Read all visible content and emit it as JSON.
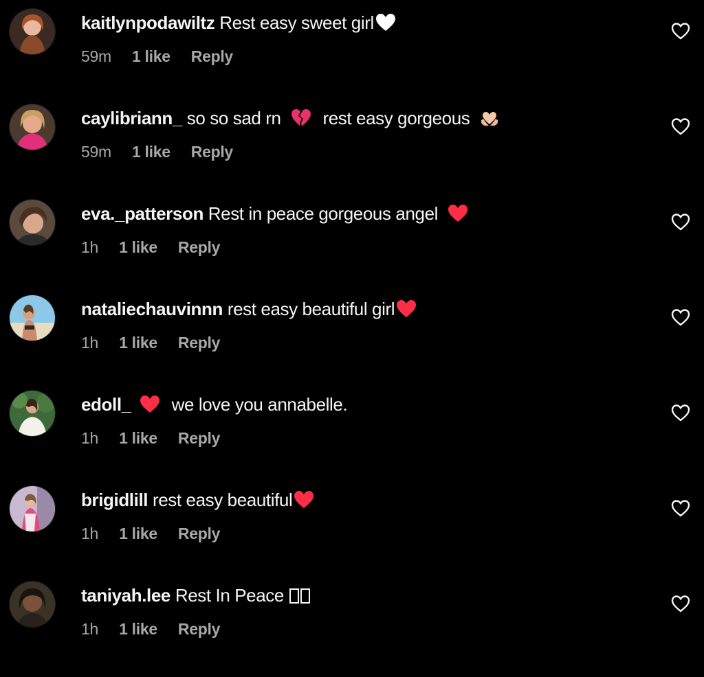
{
  "colors": {
    "background": "#000000",
    "primary_text": "#f5f5f5",
    "secondary_text": "#a8a8a8",
    "heart_red": "#ff2d45",
    "heart_white": "#ffffff"
  },
  "comments": [
    {
      "username": "kaitlynpodawiltz",
      "text": "Rest easy sweet girl",
      "emoji": "white-heart",
      "time": "59m",
      "likes": "1 like",
      "reply": "Reply",
      "avatar": "portrait-auburn-hair"
    },
    {
      "username": "caylibriann_",
      "text": "so so sad rn",
      "text_after": "rest easy gorgeous",
      "emoji": "broken-heart",
      "emoji_after": "heart-hands",
      "time": "59m",
      "likes": "1 like",
      "reply": "Reply",
      "avatar": "portrait-blonde-hair"
    },
    {
      "username": "eva._patterson",
      "text": "Rest in peace gorgeous angel",
      "emoji": "red-heart",
      "time": "1h",
      "likes": "1 like",
      "reply": "Reply",
      "avatar": "portrait-brown-hair"
    },
    {
      "username": "nataliechauvinnn",
      "text": "rest easy beautiful girl",
      "emoji": "red-heart",
      "time": "1h",
      "likes": "1 like",
      "reply": "Reply",
      "avatar": "beach-photo"
    },
    {
      "username": "edoll_",
      "text": "we love you annabelle.",
      "emoji_before": "red-heart",
      "time": "1h",
      "likes": "1 like",
      "reply": "Reply",
      "avatar": "portrait-greenery"
    },
    {
      "username": "brigidlill",
      "text": "rest easy beautiful",
      "emoji": "red-heart",
      "time": "1h",
      "likes": "1 like",
      "reply": "Reply",
      "avatar": "portrait-pink-outfit"
    },
    {
      "username": "taniyah.lee",
      "text": "Rest In Peace",
      "emoji": "missing-glyph",
      "time": "1h",
      "likes": "1 like",
      "reply": "Reply",
      "avatar": "portrait-dark-hair"
    }
  ]
}
